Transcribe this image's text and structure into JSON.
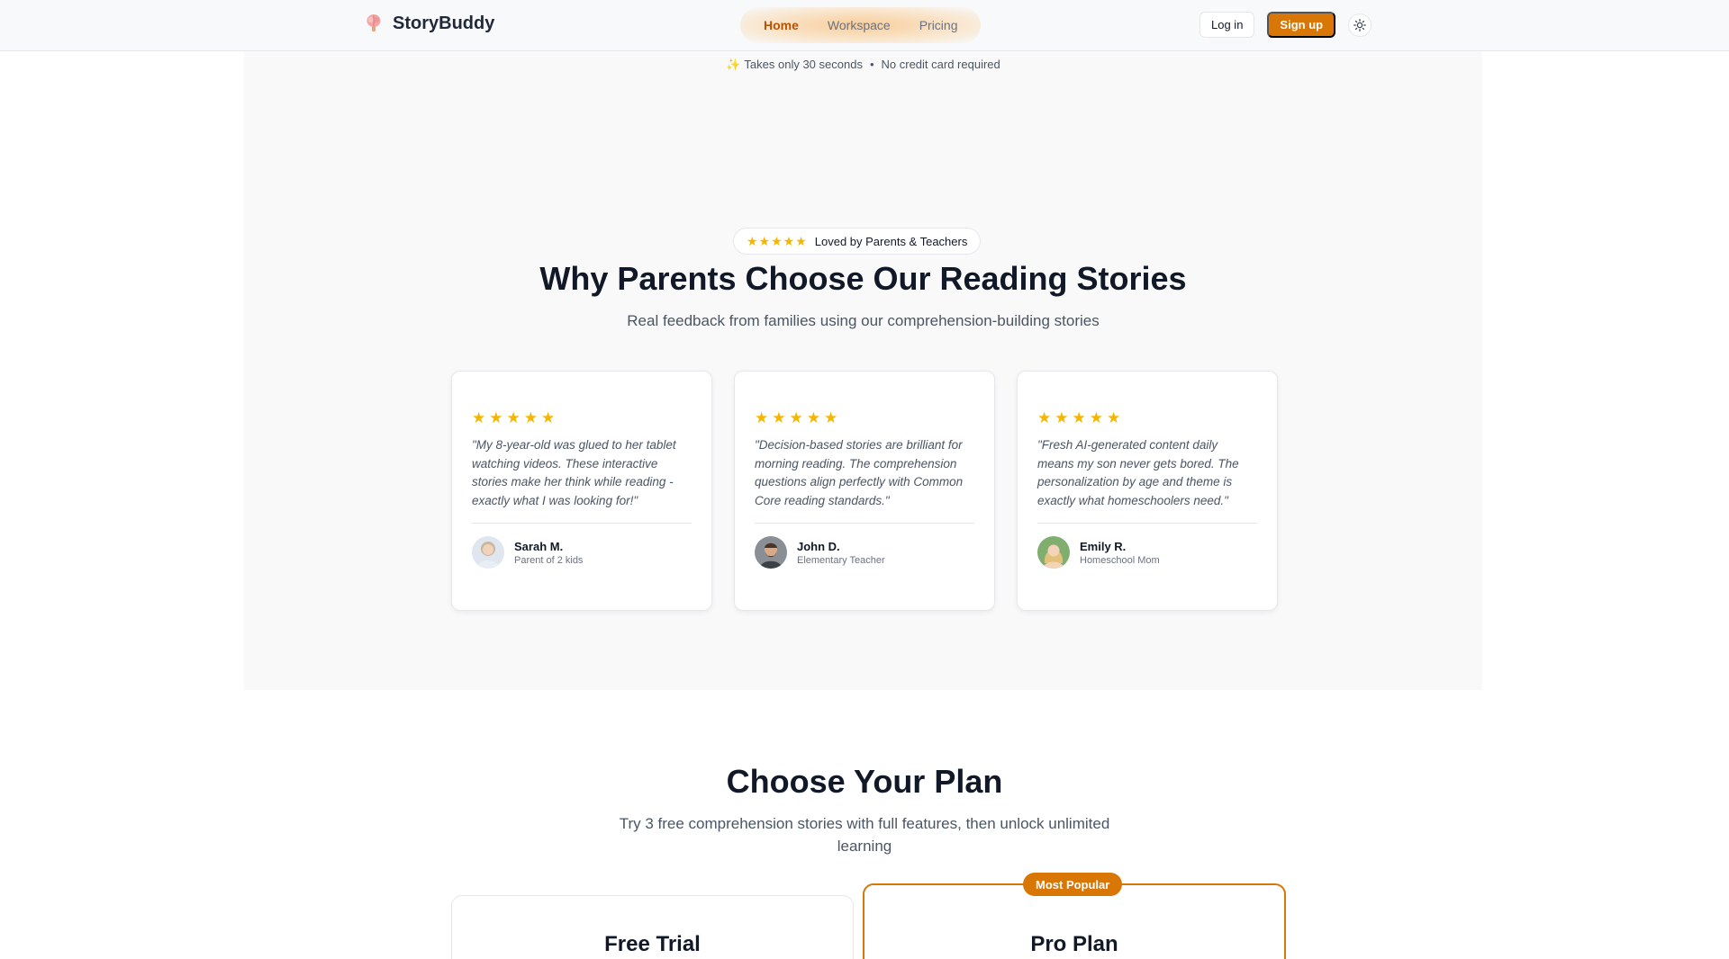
{
  "header": {
    "brand": "StoryBuddy",
    "nav": [
      "Home",
      "Workspace",
      "Pricing"
    ],
    "active_nav": "Home",
    "login_label": "Log in",
    "signup_label": "Sign up",
    "theme_icon": "sun-icon",
    "accent_color": "#d97706"
  },
  "note": {
    "icon": "sparkle-icon",
    "text1": "Takes only 30 seconds",
    "separator": "•",
    "text2": "No credit card required"
  },
  "testimonials": {
    "badge_text": "Loved by Parents & Teachers",
    "badge_rating": 5,
    "title": "Why Parents Choose Our Reading Stories",
    "subtitle": "Real feedback from families using our comprehension-building stories",
    "cards": [
      {
        "rating": 5,
        "quote": "\"My 8-year-old was glued to her tablet watching videos. These interactive stories make her think while reading - exactly what I was looking for!\"",
        "name": "Sarah M.",
        "role": "Parent of 2 kids"
      },
      {
        "rating": 5,
        "quote": "\"Decision-based stories are brilliant for morning reading. The comprehension questions align perfectly with Common Core reading standards.\"",
        "name": "John D.",
        "role": "Elementary Teacher"
      },
      {
        "rating": 5,
        "quote": "\"Fresh AI-generated content daily means my son never gets bored. The personalization by age and theme is exactly what homeschoolers need.\"",
        "name": "Emily R.",
        "role": "Homeschool Mom"
      }
    ]
  },
  "pricing": {
    "title": "Choose Your Plan",
    "subtitle": "Try 3 free comprehension stories with full features, then unlock unlimited learning",
    "plans": [
      {
        "name": "Free Trial"
      },
      {
        "name": "Pro Plan",
        "badge": "Most Popular"
      }
    ]
  }
}
